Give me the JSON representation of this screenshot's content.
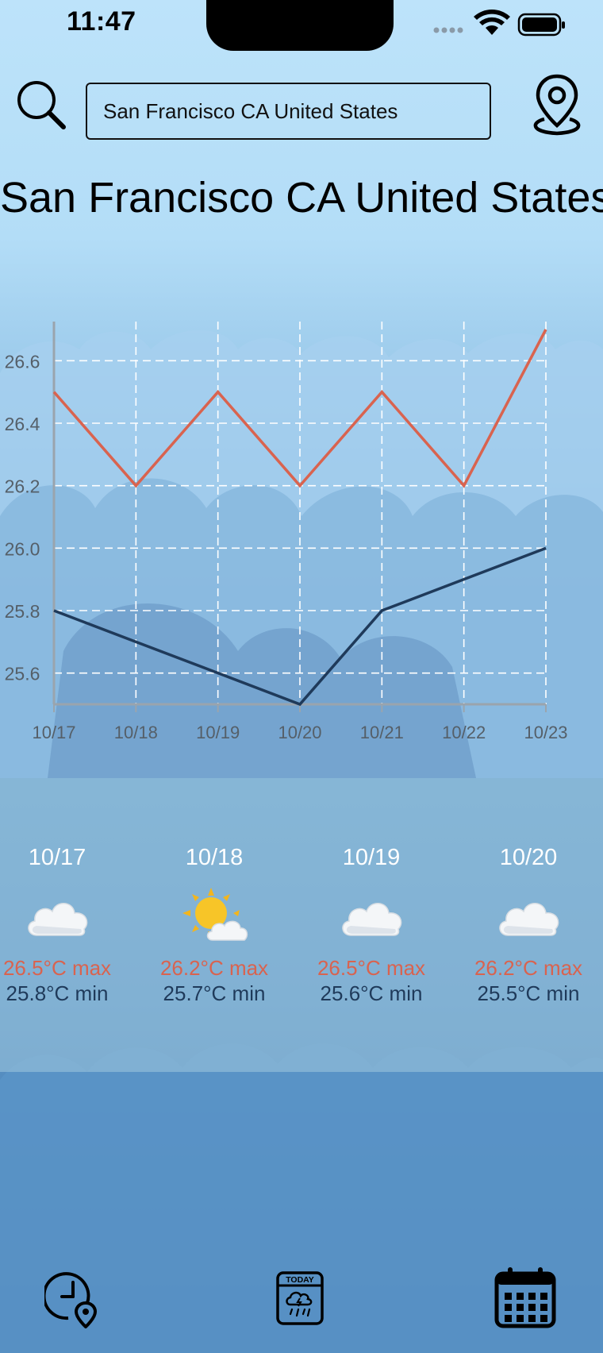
{
  "status_bar": {
    "time": "11:47",
    "icons": [
      "cellular-dots-icon",
      "wifi-icon",
      "battery-icon"
    ]
  },
  "search": {
    "icon": "search-icon",
    "value": "San Francisco CA United States",
    "placeholder": "",
    "location_icon": "location-pin-icon"
  },
  "title": "San Francisco CA United States",
  "chart_data": {
    "type": "line",
    "title": "",
    "xlabel": "",
    "ylabel": "",
    "categories": [
      "10/17",
      "10/18",
      "10/19",
      "10/20",
      "10/21",
      "10/22",
      "10/23"
    ],
    "series": [
      {
        "color": "#d9634f",
        "values": [
          26.5,
          26.2,
          26.5,
          26.2,
          26.5,
          26.2,
          26.7
        ]
      },
      {
        "color": "#1f3a5a",
        "values": [
          25.8,
          25.7,
          25.6,
          25.5,
          25.8,
          25.9,
          26.0
        ]
      }
    ],
    "ylim": [
      25.5,
      26.7
    ],
    "yticks": [
      "25.6",
      "25.8",
      "26.0",
      "26.2",
      "26.4",
      "26.6"
    ],
    "grid": true,
    "grid_style": "dashed",
    "legend": "none"
  },
  "forecast": [
    {
      "date": "10/17",
      "icon": "cloud-icon",
      "max": "26.5°C max",
      "min": "25.8°C min"
    },
    {
      "date": "10/18",
      "icon": "sun-behind-cloud-icon",
      "max": "26.2°C max",
      "min": "25.7°C min"
    },
    {
      "date": "10/19",
      "icon": "cloud-icon",
      "max": "26.5°C max",
      "min": "25.6°C min"
    },
    {
      "date": "10/20",
      "icon": "cloud-icon",
      "max": "26.2°C max",
      "min": "25.5°C min"
    }
  ],
  "tabs": [
    {
      "name": "current",
      "icon": "clock-location-icon"
    },
    {
      "name": "today",
      "icon": "today-calendar-icon",
      "label": "TODAY"
    },
    {
      "name": "weekly",
      "icon": "calendar-grid-icon"
    }
  ],
  "colors": {
    "max_temp": "#d9634f",
    "min_temp": "#1f3a5a",
    "date_text": "#ffffff"
  }
}
